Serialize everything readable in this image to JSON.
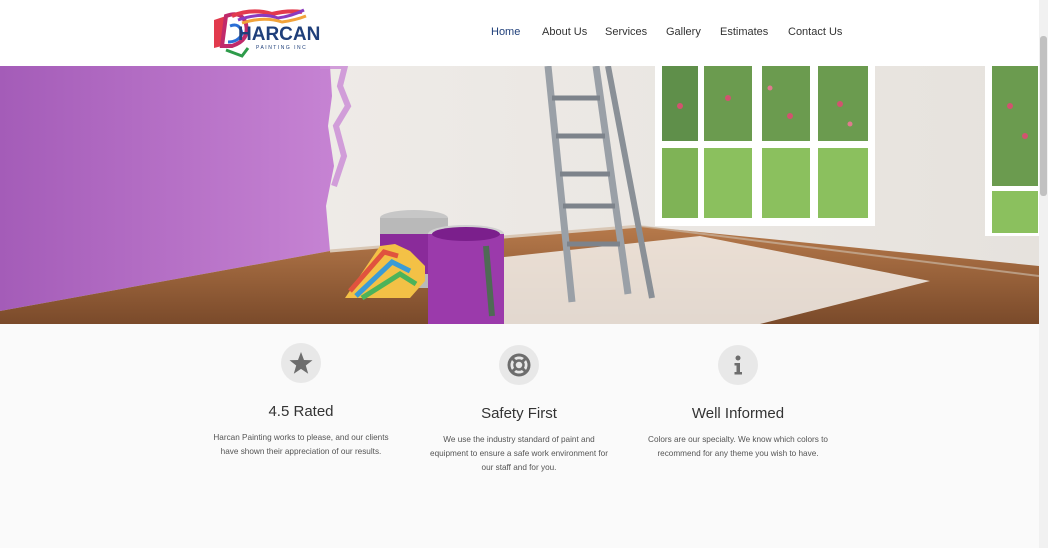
{
  "header": {
    "logo": {
      "name": "HARCAN",
      "tagline": "PAINTING INC"
    },
    "nav": [
      {
        "label": "Home",
        "active": true
      },
      {
        "label": "About Us",
        "active": false
      },
      {
        "label": "Services",
        "active": false
      },
      {
        "label": "Gallery",
        "active": false
      },
      {
        "label": "Estimates",
        "active": false
      },
      {
        "label": "Contact Us",
        "active": false
      }
    ]
  },
  "hero": {
    "image": "room-with-purple-wall-paint-cans-ladder-window"
  },
  "features": [
    {
      "icon": "star-icon",
      "title": "4.5 Rated",
      "text_lines": [
        "Harcan Painting works to please, and our clients",
        "have shown their appreciation of our results."
      ]
    },
    {
      "icon": "life-ring-icon",
      "title": "Safety First",
      "text_lines": [
        "We use the industry standard of paint and",
        "equipment to ensure a safe work environment for",
        "our staff and for you."
      ]
    },
    {
      "icon": "info-icon",
      "title": "Well Informed",
      "text_lines": [
        "Colors are our specialty. We know which colors to",
        "recommend for any theme you wish to have."
      ]
    }
  ],
  "colors": {
    "brand_navy": "#1f3f7a",
    "wall_purple": "#b46dc4",
    "icon_circle": "#e8e8e8",
    "icon_glyph": "#6d6d6d"
  }
}
